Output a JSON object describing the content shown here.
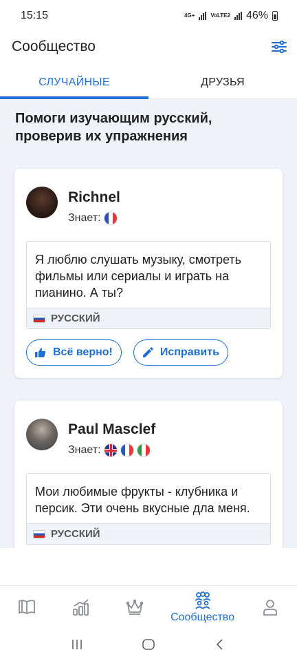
{
  "status_bar": {
    "time": "15:15",
    "net_top": "4G+",
    "net_bottom": "VoLTE2",
    "battery": "46%"
  },
  "app_bar": {
    "title": "Сообщество",
    "filter_icon": "sliders-icon"
  },
  "tabs": [
    {
      "label": "СЛУЧАЙНЫЕ",
      "active": true
    },
    {
      "label": "ДРУЗЬЯ",
      "active": false
    }
  ],
  "feed": {
    "heading": "Помоги изучающим русский, проверив их упражнения",
    "cards": [
      {
        "name": "Richnel",
        "knows_label": "Знает:",
        "knows_flags": [
          "fr"
        ],
        "text": "Я люблю слушать музыку, смотреть фильмы или сериалы и играть на пианино. А ты?",
        "language": "РУССКИЙ",
        "like_label": "Всё верно!",
        "correct_label": "Исправить"
      },
      {
        "name": "Paul Masclef",
        "knows_label": "Знает:",
        "knows_flags": [
          "gb",
          "fr",
          "it"
        ],
        "text": "Мои любимые фрукты - клубника и персик. Эти очень вкусные дла меня.",
        "language": "РУССКИЙ"
      }
    ]
  },
  "bottom_nav": [
    {
      "icon": "book-icon",
      "label": ""
    },
    {
      "icon": "progress-chart-icon",
      "label": ""
    },
    {
      "icon": "crown-icon",
      "label": ""
    },
    {
      "icon": "community-icon",
      "label": "Сообщество",
      "active": true
    },
    {
      "icon": "profile-icon",
      "label": ""
    }
  ],
  "colors": {
    "accent": "#1f6fd1",
    "feed_background": "#eef3fa",
    "inactive": "#8a8f96"
  }
}
